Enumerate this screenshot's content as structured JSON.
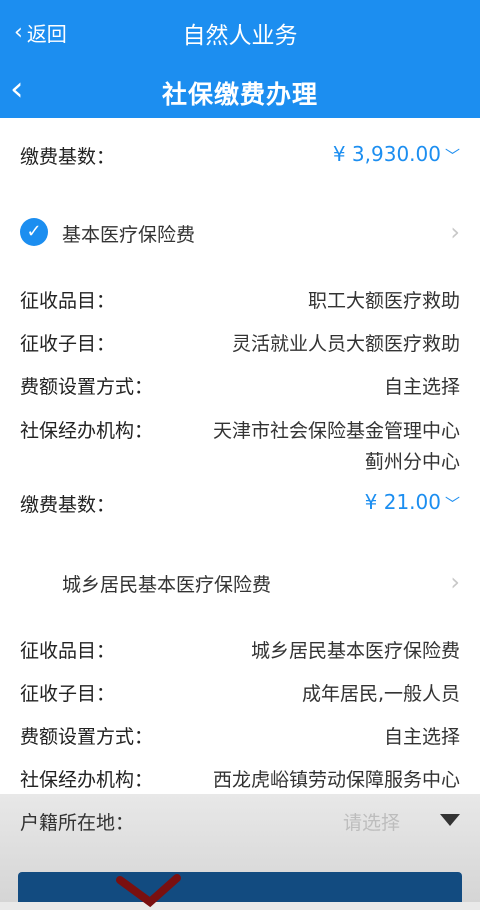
{
  "top_bar": {
    "back_label": "返回",
    "title": "自然人业务"
  },
  "sub_bar": {
    "title": "社保缴费办理"
  },
  "top_base": {
    "label": "缴费基数：",
    "value": "¥ 3,930.00"
  },
  "section1": {
    "name": "基本医疗保险费",
    "checked": true
  },
  "section1_rows": [
    {
      "k": "征收品目：",
      "v": "职工大额医疗救助"
    },
    {
      "k": "征收子目：",
      "v": "灵活就业人员大额医疗救助"
    },
    {
      "k": "费额设置方式：",
      "v": "自主选择"
    },
    {
      "k": "社保经办机构：",
      "v": "天津市社会保险基金管理中心"
    }
  ],
  "section1_agency_line2": "蓟州分中心",
  "section1_base": {
    "label": "缴费基数：",
    "value": "¥ 21.00"
  },
  "section2": {
    "name": "城乡居民基本医疗保险费"
  },
  "section2_rows": [
    {
      "k": "征收品目：",
      "v": "城乡居民基本医疗保险费"
    },
    {
      "k": "征收子目：",
      "v": "成年居民,一般人员"
    },
    {
      "k": "费额设置方式：",
      "v": "自主选择"
    },
    {
      "k": "社保经办机构：",
      "v": "西龙虎峪镇劳动保障服务中心"
    }
  ],
  "household": {
    "label": "户籍所在地：",
    "placeholder": "请选择"
  },
  "colors": {
    "primary": "#1c8ef0"
  }
}
